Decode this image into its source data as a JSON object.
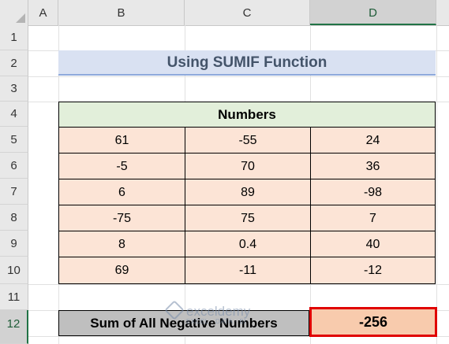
{
  "columns": [
    "A",
    "B",
    "C",
    "D"
  ],
  "rows": [
    "1",
    "2",
    "3",
    "4",
    "5",
    "6",
    "7",
    "8",
    "9",
    "10",
    "11",
    "12"
  ],
  "selected_column": "D",
  "selected_row": "12",
  "title": "Using SUMIF Function",
  "table": {
    "header": "Numbers",
    "rows": [
      [
        "61",
        "-55",
        "24"
      ],
      [
        "-5",
        "70",
        "36"
      ],
      [
        "6",
        "89",
        "-98"
      ],
      [
        "-75",
        "75",
        "7"
      ],
      [
        "8",
        "0.4",
        "40"
      ],
      [
        "69",
        "-11",
        "-12"
      ]
    ]
  },
  "summary": {
    "label": "Sum of All Negative Numbers",
    "value": "-256"
  },
  "watermark": {
    "name": "exceldemy",
    "tagline": "EXCEL · DATA · BI"
  },
  "colors": {
    "title_fill": "#d9e1f2",
    "header_fill": "#e2efda",
    "cell_fill": "#fce4d6",
    "label_fill": "#bfbfbf",
    "result_fill": "#f8cbad",
    "result_border": "#e00000",
    "selection_accent": "#217346"
  }
}
